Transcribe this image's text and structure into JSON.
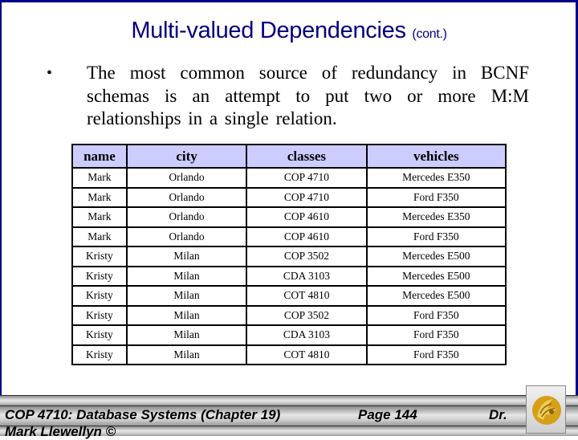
{
  "slide": {
    "title": "Multi-valued Dependencies",
    "title_suffix": "(cont.)",
    "bullet_symbol": "•",
    "bullet_text": "The most common source of redundancy in BCNF schemas is an attempt to put two or more M:M relationships in a single relation."
  },
  "table": {
    "headers": [
      "name",
      "city",
      "classes",
      "vehicles"
    ],
    "rows": [
      [
        "Mark",
        "Orlando",
        "COP 4710",
        "Mercedes E350"
      ],
      [
        "Mark",
        "Orlando",
        "COP 4710",
        "Ford F350"
      ],
      [
        "Mark",
        "Orlando",
        "COP 4610",
        "Mercedes E350"
      ],
      [
        "Mark",
        "Orlando",
        "COP 4610",
        "Ford F350"
      ],
      [
        "Kristy",
        "Milan",
        "COP 3502",
        "Mercedes E500"
      ],
      [
        "Kristy",
        "Milan",
        "CDA 3103",
        "Mercedes E500"
      ],
      [
        "Kristy",
        "Milan",
        "COT 4810",
        "Mercedes E500"
      ],
      [
        "Kristy",
        "Milan",
        "COP 3502",
        "Ford F350"
      ],
      [
        "Kristy",
        "Milan",
        "CDA 3103",
        "Ford F350"
      ],
      [
        "Kristy",
        "Milan",
        "COT 4810",
        "Ford F350"
      ]
    ]
  },
  "footer": {
    "course": "COP 4710: Database Systems  (Chapter 19)",
    "page": "Page 144",
    "author_prefix": "Dr.",
    "author_line2": "Mark Llewellyn ©",
    "logo_icon": "pegasus-logo-icon"
  },
  "colors": {
    "frame_border": "#00008b",
    "title_text": "#000080",
    "table_header_bg": "#ccccff",
    "logo_gold": "#d4a017"
  }
}
